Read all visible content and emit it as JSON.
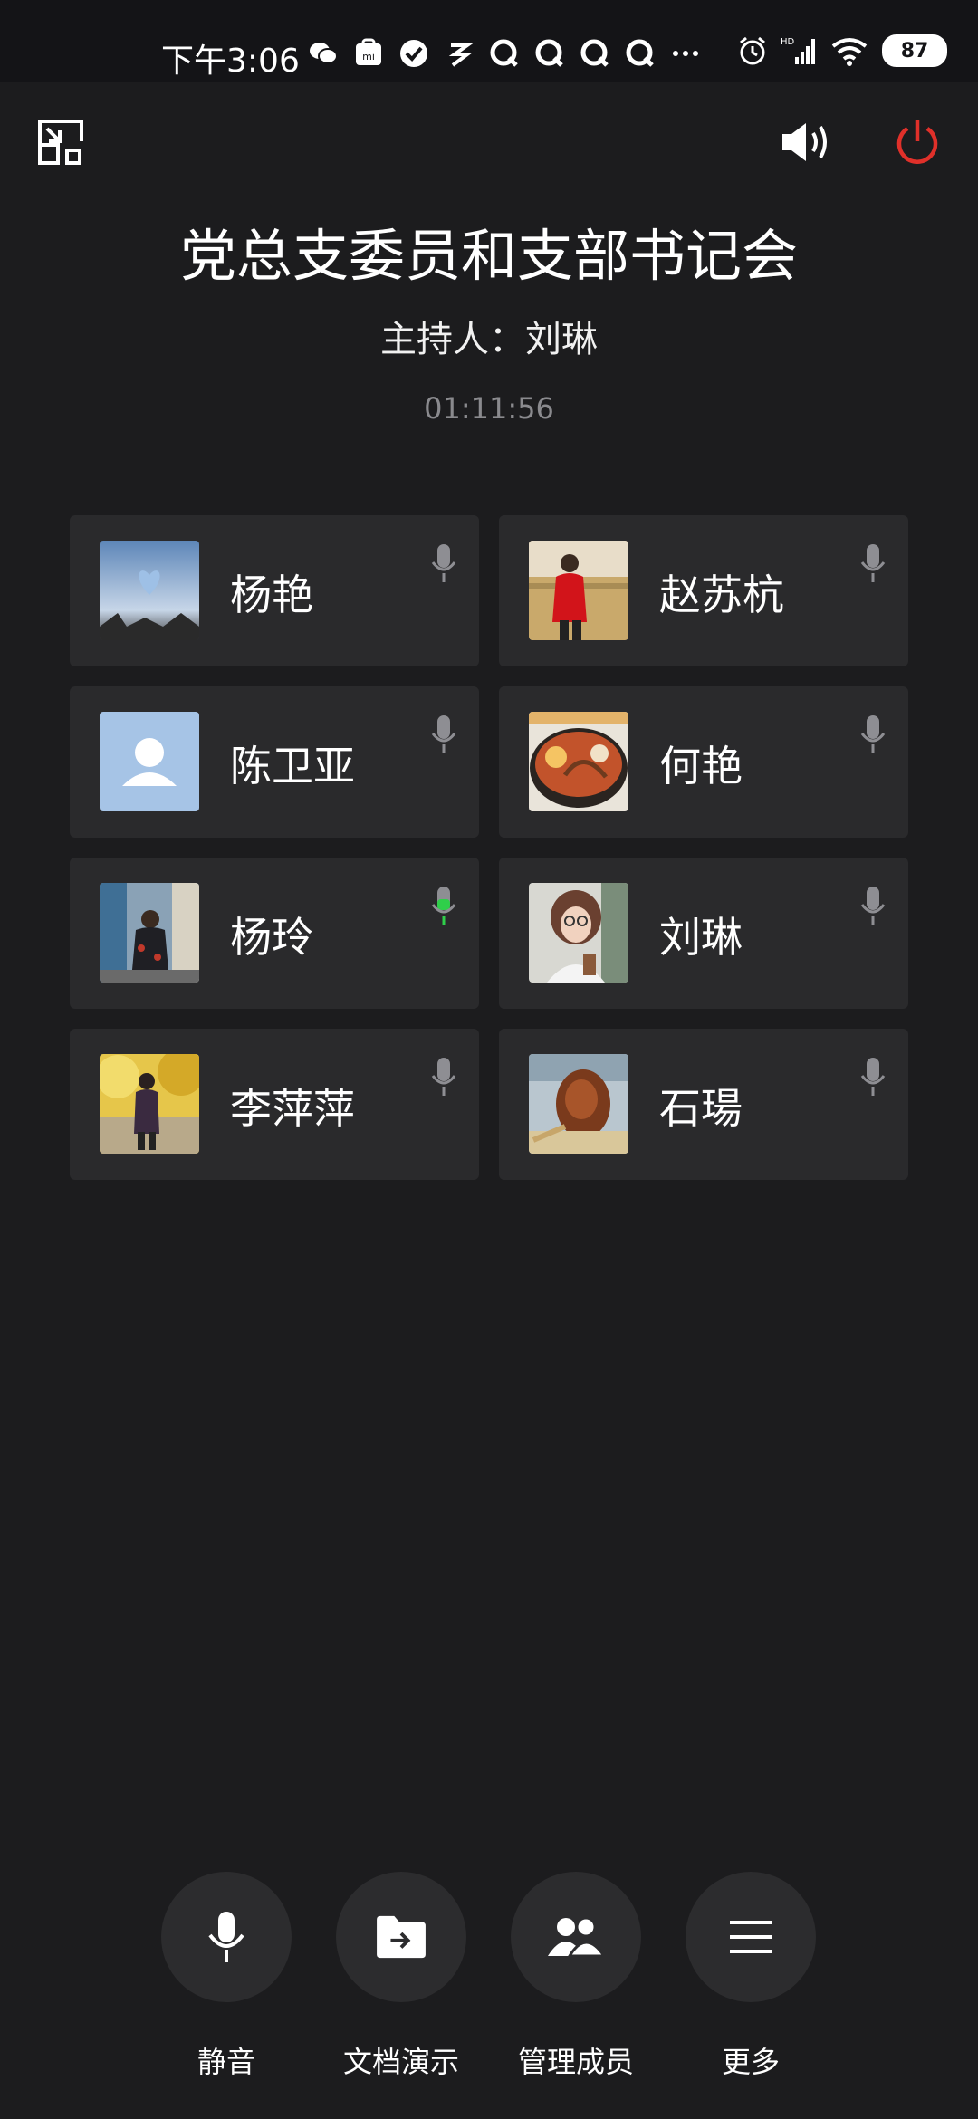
{
  "status_bar": {
    "time": "下午3:06",
    "signal_label": "HD",
    "battery": "87"
  },
  "meeting": {
    "title": "党总支委员和支部书记会",
    "host_label": "主持人：",
    "host_name": "刘琳",
    "elapsed": "01:11:56"
  },
  "participants": [
    {
      "name": "杨艳",
      "avatar": "sky-heart-photo",
      "mic": "idle"
    },
    {
      "name": "赵苏杭",
      "avatar": "person-red-field-photo",
      "mic": "idle"
    },
    {
      "name": "陈卫亚",
      "avatar": "default-person-avatar",
      "mic": "idle"
    },
    {
      "name": "何艳",
      "avatar": "food-hotpot-photo",
      "mic": "idle"
    },
    {
      "name": "杨玲",
      "avatar": "person-street-photo",
      "mic": "speaking"
    },
    {
      "name": "刘琳",
      "avatar": "woman-glasses-photo",
      "mic": "idle"
    },
    {
      "name": "李萍萍",
      "avatar": "person-autumn-trees-photo",
      "mic": "idle"
    },
    {
      "name": "石瑒",
      "avatar": "roast-duck-photo",
      "mic": "idle"
    }
  ],
  "toolbar": {
    "mute_label": "静音",
    "share_label": "文档演示",
    "members_label": "管理成员",
    "more_label": "更多"
  },
  "colors": {
    "background": "#1c1c1e",
    "card": "#2a2a2c",
    "hangup": "#e0302a",
    "speaking_mic": "#2fcf4a",
    "idle_mic": "#8e8e93"
  }
}
